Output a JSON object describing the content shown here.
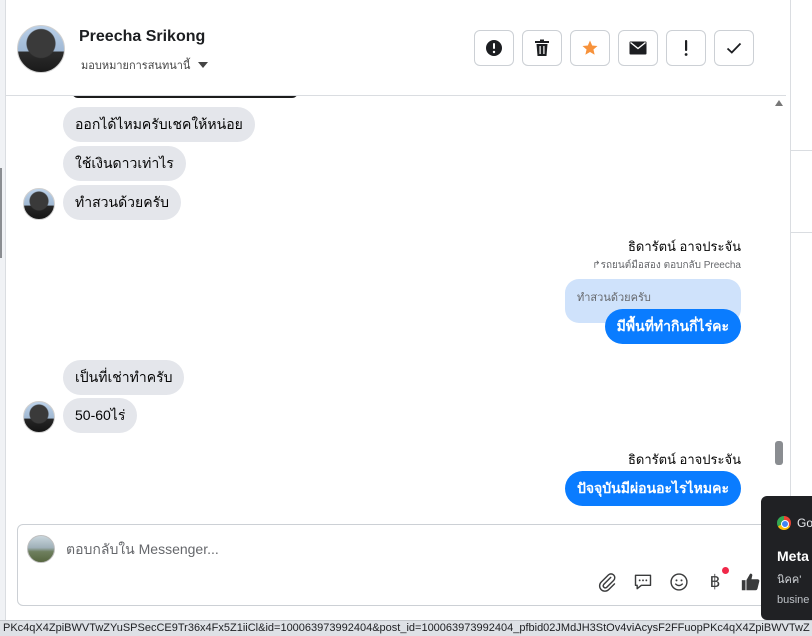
{
  "header": {
    "contact_name": "Preecha Srikong",
    "assign_label": "มอบหมายการสนทนานี้",
    "actions": [
      {
        "name": "report-button",
        "icon": "alert-circle-icon"
      },
      {
        "name": "delete-button",
        "icon": "trash-icon"
      },
      {
        "name": "star-button",
        "icon": "star-icon"
      },
      {
        "name": "mark-unread-button",
        "icon": "envelope-icon"
      },
      {
        "name": "spam-button",
        "icon": "exclamation-icon"
      },
      {
        "name": "done-button",
        "icon": "checkmark-icon"
      }
    ]
  },
  "messages": {
    "group1": [
      {
        "text": "ออกได้ไหมครับเชคให้หน่อย"
      },
      {
        "text": "ใช้เงินดาวเท่าไร"
      },
      {
        "text": "ทำสวนด้วยครับ"
      }
    ],
    "outgoing1": {
      "sender": "ธิดารัตน์ อาจประจัน",
      "reply_note": "รถยนต์มือสอง ตอบกลับ Preecha",
      "quoted_text": "ทำสวนด้วยครับ",
      "text": "มีพื้นที่ทำกินกี่ไร่คะ"
    },
    "group2": [
      {
        "text": "เป็นที่เช่าทำครับ"
      },
      {
        "text": "50-60ไร่"
      }
    ],
    "outgoing2": {
      "sender": "ธิดารัตน์ อาจประจัน",
      "text": "ปัจจุบันมีผ่อนอะไรไหมคะ"
    }
  },
  "composer": {
    "placeholder": "ตอบกลับใน Messenger...",
    "tools": [
      "paperclip-icon",
      "speech-bubble-icon",
      "emoji-icon",
      "baht-payment-icon",
      "thumbs-up-icon"
    ],
    "baht_symbol": "฿"
  },
  "toast": {
    "app": "Go",
    "title": "Meta",
    "body": "นิคค' ",
    "source": "busine"
  },
  "statusbar": {
    "url": "PKc4qX4ZpiBWVTwZYuSPSecCE9Tr36x4Fx5Z1iiCl&id=100063973992404&post_id=100063973992404_pfbid02JMdJH3StOv4viAcysF2FFuopPKc4qX4ZpiBWVTwZ"
  },
  "colors": {
    "accent": "#0a7cff",
    "incoming_bubble": "#e4e6eb",
    "quoted_bubble": "#cfe2fb",
    "star": "#f7923b",
    "notification_dot": "#f02849"
  }
}
